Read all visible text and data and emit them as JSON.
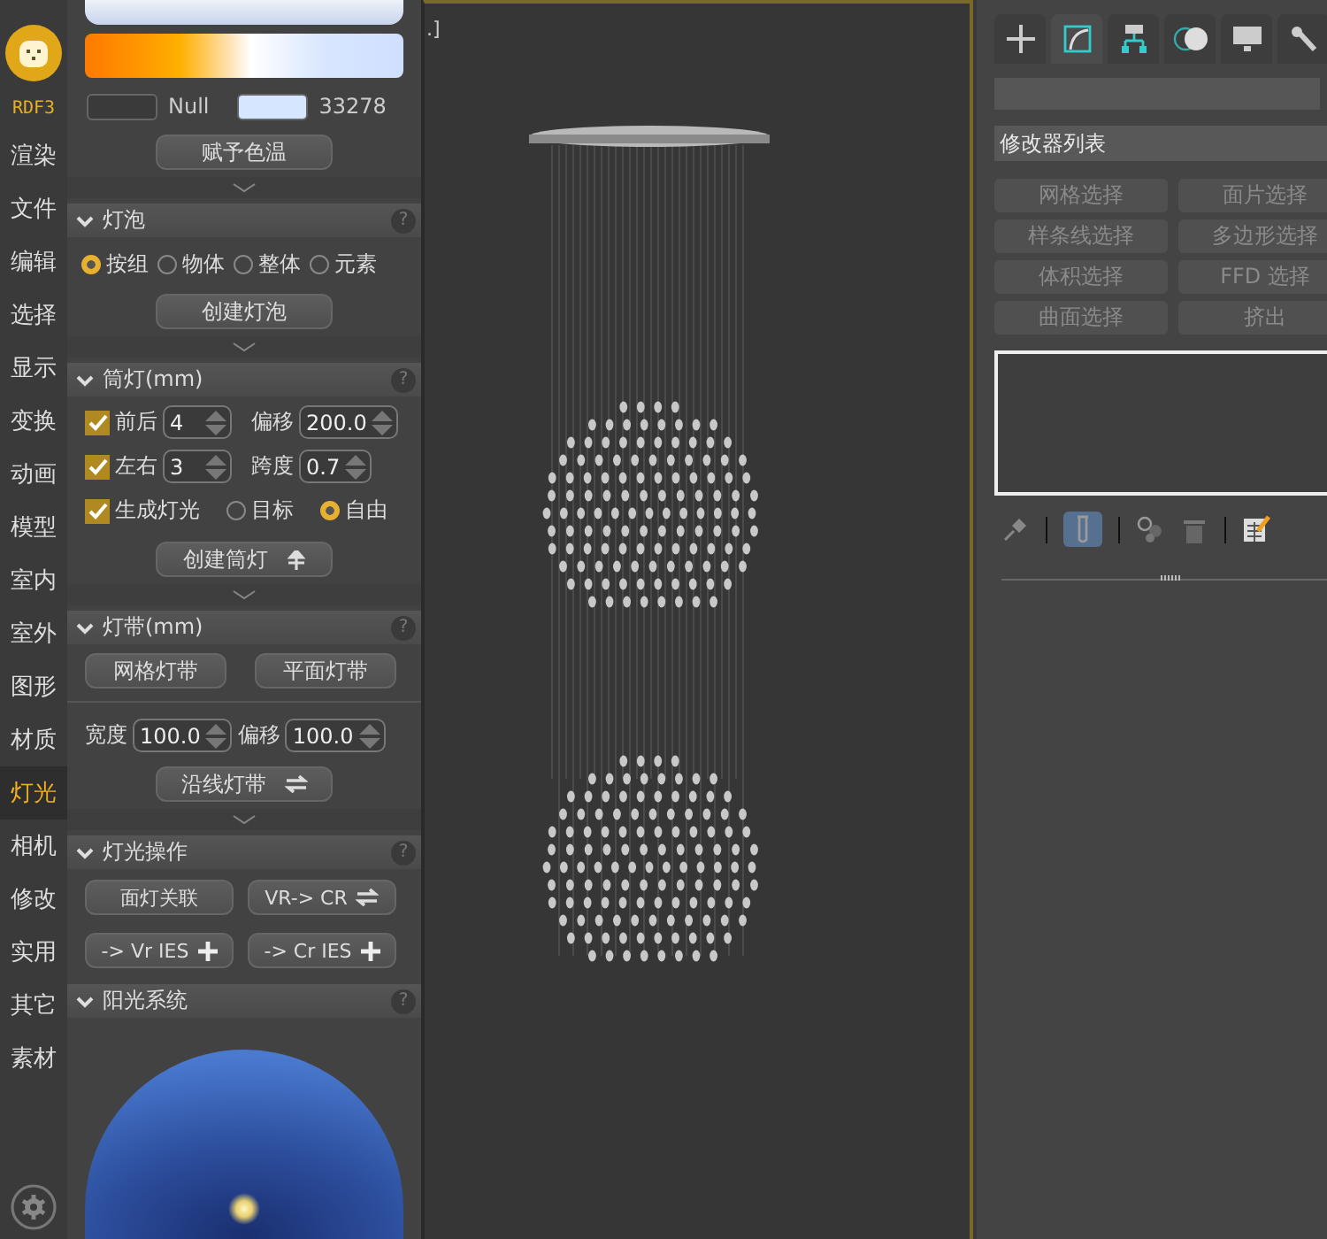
{
  "nav": {
    "brand": "RDF3",
    "items": [
      {
        "label": "渲染",
        "selected": false
      },
      {
        "label": "文件",
        "selected": false
      },
      {
        "label": "编辑",
        "selected": false
      },
      {
        "label": "选择",
        "selected": false
      },
      {
        "label": "显示",
        "selected": false
      },
      {
        "label": "变换",
        "selected": false
      },
      {
        "label": "动画",
        "selected": false
      },
      {
        "label": "模型",
        "selected": false
      },
      {
        "label": "室内",
        "selected": false
      },
      {
        "label": "室外",
        "selected": false
      },
      {
        "label": "图形",
        "selected": false
      },
      {
        "label": "材质",
        "selected": false
      },
      {
        "label": "灯光",
        "selected": true
      },
      {
        "label": "相机",
        "selected": false
      },
      {
        "label": "修改",
        "selected": false
      },
      {
        "label": "实用",
        "selected": false
      },
      {
        "label": "其它",
        "selected": false
      },
      {
        "label": "素材",
        "selected": false
      }
    ]
  },
  "color_temperature": {
    "swatches": [
      {
        "kind": "empty",
        "label": "Null"
      },
      {
        "kind": "filled",
        "color": "#d6e6ff",
        "label": "33278"
      }
    ],
    "button": "赋予色温"
  },
  "bulb": {
    "title": "灯泡",
    "help": "?",
    "options": [
      {
        "label": "按组",
        "selected": true
      },
      {
        "label": "物体",
        "selected": false
      },
      {
        "label": "整体",
        "selected": false
      },
      {
        "label": "元素",
        "selected": false
      }
    ],
    "button": "创建灯泡"
  },
  "downlight": {
    "title": "筒灯(mm)",
    "help": "?",
    "rows": [
      {
        "label": "前后",
        "checked": true,
        "value": "4",
        "field_label": "偏移",
        "field_value": "200.0"
      },
      {
        "label": "左右",
        "checked": true,
        "value": "3",
        "field_label": "跨度",
        "field_value": "0.7"
      }
    ],
    "generate": {
      "label": "生成灯光",
      "checked": true
    },
    "options": [
      {
        "label": "目标",
        "selected": false
      },
      {
        "label": "自由",
        "selected": true
      }
    ],
    "button": {
      "label": "创建筒灯",
      "kind": "cross"
    }
  },
  "strip": {
    "title": "灯带(mm)",
    "help": "?",
    "buttons": [
      "网格灯带",
      "平面灯带"
    ],
    "fields": [
      {
        "label": "宽度",
        "value": "100.0"
      },
      {
        "label": "偏移",
        "value": "100.0"
      }
    ],
    "button": {
      "label": "沿线灯带",
      "kind": "swap"
    }
  },
  "light_ops": {
    "title": "灯光操作",
    "help": "?",
    "buttons": [
      {
        "label": "面灯关联",
        "kind": "plain"
      },
      {
        "label": "VR-> CR",
        "kind": "swap"
      },
      {
        "label": "-> Vr IES",
        "kind": "plus"
      },
      {
        "label": "-> Cr IES",
        "kind": "plus"
      }
    ]
  },
  "sun": {
    "title": "阳光系统",
    "help": "?"
  },
  "viewport": {
    "label": ".]"
  },
  "command_tabs": [
    {
      "kind": "create",
      "selected": false
    },
    {
      "kind": "modify",
      "selected": true
    },
    {
      "kind": "hierarchy",
      "selected": false
    },
    {
      "kind": "motion",
      "selected": false
    },
    {
      "kind": "display",
      "selected": false
    },
    {
      "kind": "utilities",
      "selected": false
    }
  ],
  "modifier_list": "修改器列表",
  "modifier_buttons": [
    {
      "label": "网格选择",
      "disabled": true
    },
    {
      "label": "面片选择",
      "disabled": true
    },
    {
      "label": "样条线选择",
      "disabled": true
    },
    {
      "label": "多边形选择",
      "disabled": true
    },
    {
      "label": "体积选择",
      "disabled": true
    },
    {
      "label": "FFD 选择",
      "disabled": true
    },
    {
      "label": "曲面选择",
      "disabled": true
    },
    {
      "label": "挤出",
      "disabled": true
    }
  ],
  "stack_tools": [
    {
      "kind": "pin",
      "selected": false
    },
    {
      "kind": "end_result",
      "selected": true
    },
    {
      "kind": "unique",
      "selected": false
    },
    {
      "kind": "remove",
      "selected": false
    },
    {
      "kind": "configure",
      "selected": false
    }
  ]
}
